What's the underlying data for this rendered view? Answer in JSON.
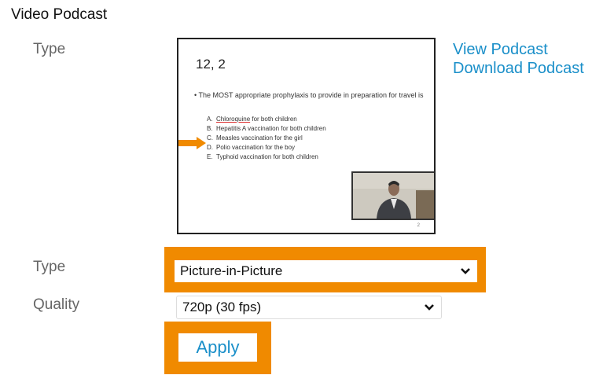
{
  "section": {
    "title": "Video Podcast"
  },
  "labels": {
    "type_top": "Type",
    "type": "Type",
    "quality": "Quality"
  },
  "thumbnail": {
    "slide_title": "12, 2",
    "question": "• The MOST appropriate prophylaxis to provide in preparation for travel is",
    "options": [
      {
        "letter": "A.",
        "text_underlined": "Chloroquine",
        "text": " for both children"
      },
      {
        "letter": "B.",
        "text_underlined": "",
        "text": "Hepatitis A vaccination for both children"
      },
      {
        "letter": "C.",
        "text_underlined": "",
        "text": "Measles vaccination for the girl"
      },
      {
        "letter": "D.",
        "text_underlined": "",
        "text": "Polio vaccination for the boy"
      },
      {
        "letter": "E.",
        "text_underlined": "",
        "text": "Typhoid vaccination for both children"
      }
    ],
    "highlighted_option": "C.",
    "arrow_color": "#f08a00",
    "page_number": "2"
  },
  "links": {
    "view": "View Podcast",
    "download": "Download Podcast"
  },
  "type_select": {
    "value": "Picture-in-Picture",
    "icon": "chevron-down-icon"
  },
  "quality_select": {
    "value": "720p (30 fps)",
    "icon": "chevron-down-icon"
  },
  "apply_button": {
    "label": "Apply"
  },
  "colors": {
    "highlight": "#f08a00",
    "link": "#1a8fc9",
    "label": "#666666"
  }
}
